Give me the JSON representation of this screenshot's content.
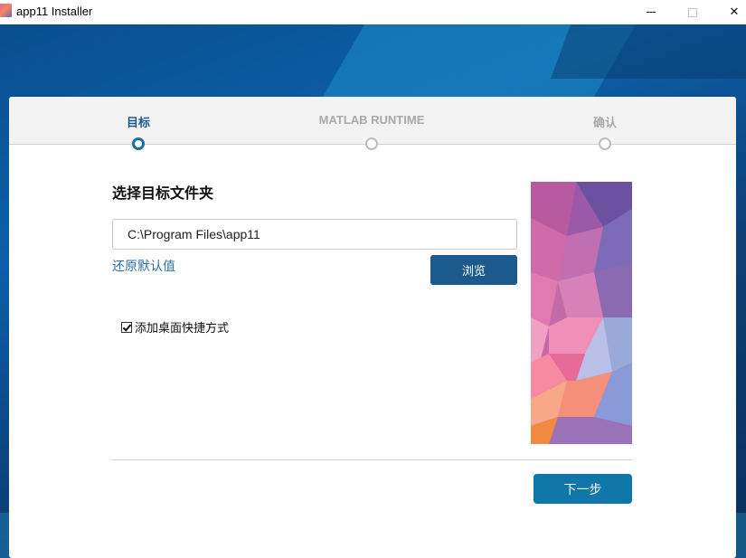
{
  "window": {
    "title": "app11 Installer",
    "minimize_icon": "minimize-icon",
    "maximize_icon": "maximize-icon",
    "close_icon": "close-icon",
    "close_glyph": "✕"
  },
  "steps": [
    {
      "label": "目标",
      "state": "active"
    },
    {
      "label": "MATLAB RUNTIME",
      "state": "inactive"
    },
    {
      "label": "确认",
      "state": "inactive"
    }
  ],
  "destination": {
    "title": "选择目标文件夹",
    "path_value": "C:\\Program Files\\app11",
    "restore_default_label": "还原默认值",
    "browse_label": "浏览"
  },
  "options": {
    "desktop_shortcut_label": "添加桌面快捷方式",
    "desktop_shortcut_checked": true
  },
  "footer": {
    "next_label": "下一步"
  },
  "colors": {
    "accent": "#1b5a8c",
    "next_button": "#0e76a8",
    "link": "#2a6fa8",
    "step_active": "#1a6fa0",
    "step_inactive": "#a9a9a9"
  }
}
